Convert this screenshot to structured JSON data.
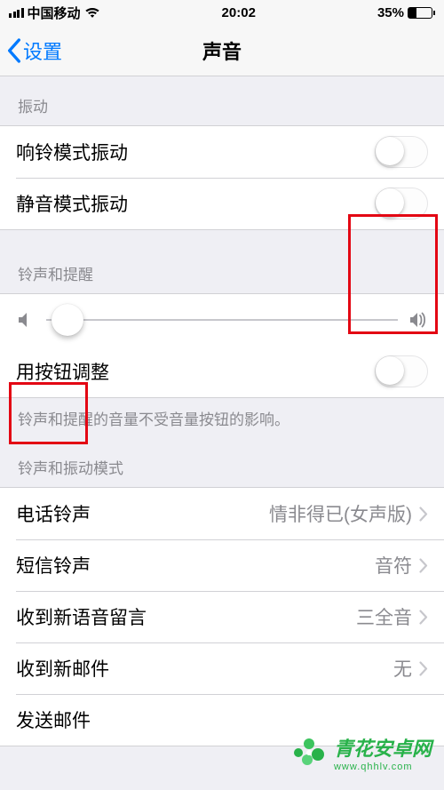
{
  "status": {
    "carrier": "中国移动",
    "time": "20:02",
    "battery_pct": "35%"
  },
  "nav": {
    "back": "设置",
    "title": "声音"
  },
  "sections": {
    "vibration_header": "振动",
    "ring_vibrate": "响铃模式振动",
    "silent_vibrate": "静音模式振动",
    "ringer_header": "铃声和提醒",
    "button_adjust": "用按钮调整",
    "footer_note": "铃声和提醒的音量不受音量按钮的影响。",
    "pattern_header": "铃声和振动模式"
  },
  "rows": {
    "ringtone": {
      "label": "电话铃声",
      "value": "情非得已(女声版)"
    },
    "text_tone": {
      "label": "短信铃声",
      "value": "音符"
    },
    "voicemail": {
      "label": "收到新语音留言",
      "value": "三全音"
    },
    "new_mail": {
      "label": "收到新邮件",
      "value": "无"
    },
    "sent_mail": {
      "label": "发送邮件",
      "value": ""
    }
  },
  "slider": {
    "value_pct": 6
  },
  "watermark": {
    "title": "青花安卓网",
    "sub": "www.qhhlv.com"
  }
}
